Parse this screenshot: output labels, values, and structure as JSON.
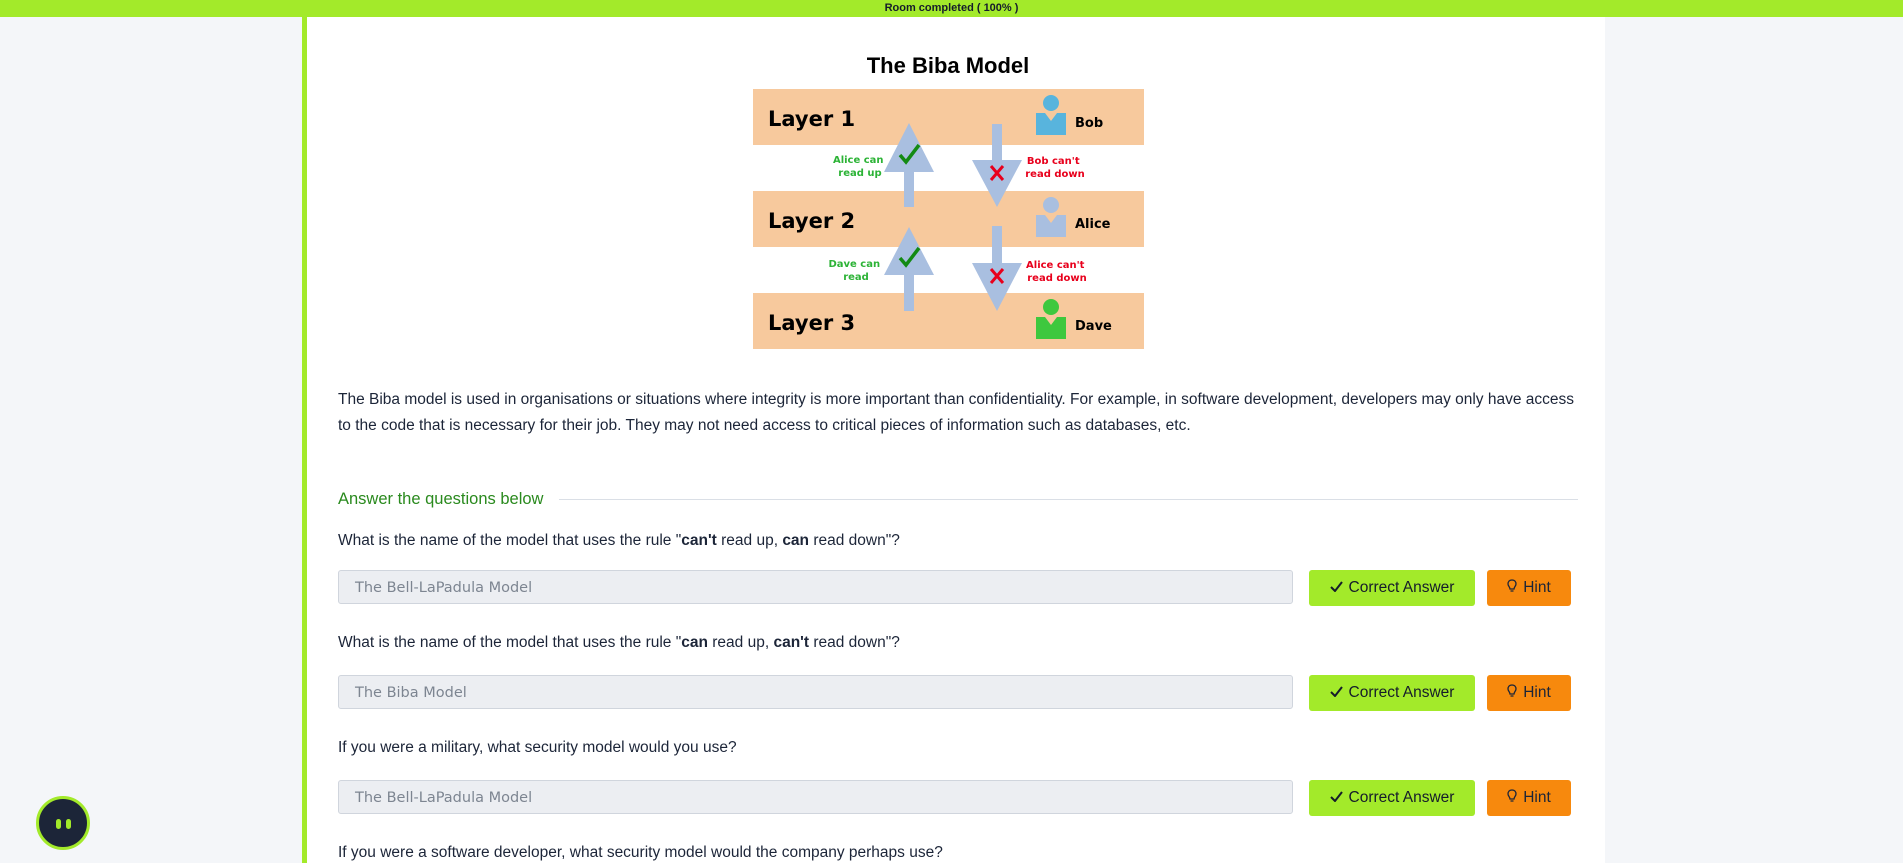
{
  "progress": {
    "label": "Room completed ( 100% )",
    "value": 1.0
  },
  "figure": {
    "title": "The Biba Model",
    "layers": [
      "Layer 1",
      "Layer 2",
      "Layer 3"
    ],
    "people": [
      "Bob",
      "Alice",
      "Dave"
    ],
    "notes": {
      "alice_can": [
        "Alice can",
        "read up"
      ],
      "bob_cant": [
        "Bob can't",
        "read down"
      ],
      "dave_can": [
        "Dave can",
        "read"
      ],
      "alice_cant": [
        "Alice can't",
        "read down"
      ]
    },
    "colors": {
      "layer": "#f7c99d",
      "arrow": "#a9bfe0",
      "allow": "#2cb336",
      "deny": "#e8001c",
      "bob": "#58b4dd",
      "alice": "#a9bfe0",
      "dave": "#3ec83e"
    }
  },
  "description": "The Biba model is used in organisations or situations where integrity is more important than confidentiality. For example, in software development, developers may only have access to the code that is necessary for their job. They may not need access to critical pieces of information such as databases, etc.",
  "section_title": "Answer the questions below",
  "questions": [
    {
      "pre": "What is the name of the model that uses the rule \"",
      "b1": "can't",
      "mid1": " read up, ",
      "b2": "can",
      "post": " read down\"?",
      "answer": "The Bell-LaPadula Model"
    },
    {
      "pre": "What is the name of the model that uses the rule \"",
      "b1": "can",
      "mid1": " read up, ",
      "b2": "can't",
      "post": " read down\"?",
      "answer": "The Biba Model"
    },
    {
      "text": "If you were a military, what security model would you use?",
      "answer": "The Bell-LaPadula Model"
    },
    {
      "text": "If you were a software developer, what security model would the company perhaps use?"
    }
  ],
  "buttons": {
    "correct": "Correct Answer",
    "hint": "Hint"
  },
  "icons": {
    "correct": "check-icon",
    "hint": "lightbulb-icon",
    "chat": "chat-bot-icon"
  },
  "accent": "#a3ea2a",
  "hint_color": "#f7890d"
}
